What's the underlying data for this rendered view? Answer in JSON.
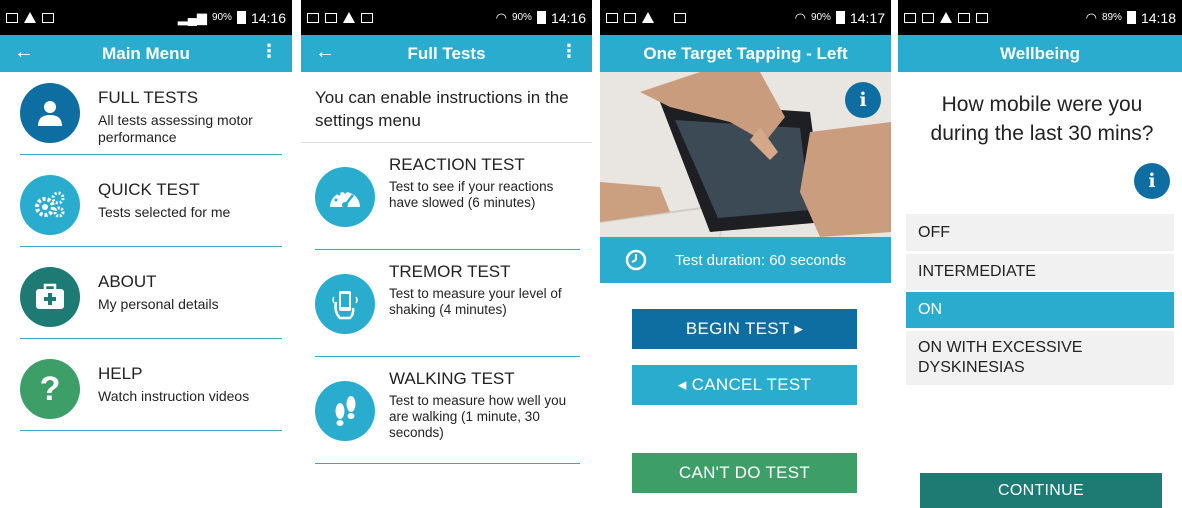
{
  "status_bars": [
    {
      "time": "14:16",
      "battery": "90%"
    },
    {
      "time": "14:16",
      "battery": "90%"
    },
    {
      "time": "14:17",
      "battery": "90%"
    },
    {
      "time": "14:18",
      "battery": "89%"
    }
  ],
  "colors": {
    "appbar": "#2aaccf",
    "dark_blue": "#0f6ea1",
    "teal": "#1d7b74",
    "green": "#3d9e67"
  },
  "main_menu": {
    "title": "Main Menu",
    "items": [
      {
        "title": "FULL TESTS",
        "subtitle": "All tests assessing motor performance",
        "icon": "person-icon"
      },
      {
        "title": "QUICK TEST",
        "subtitle": "Tests selected for me",
        "icon": "gears-icon"
      },
      {
        "title": "ABOUT",
        "subtitle": "My personal details",
        "icon": "medical-kit-icon"
      },
      {
        "title": "HELP",
        "subtitle": "Watch instruction videos",
        "icon": "question-icon"
      }
    ]
  },
  "full_tests": {
    "title": "Full Tests",
    "intro": "You can enable instructions in the settings menu",
    "items": [
      {
        "title": "REACTION TEST",
        "subtitle": "Test to see if your reactions have slowed (6 minutes)",
        "icon": "speedometer-icon"
      },
      {
        "title": "TREMOR TEST",
        "subtitle": "Test to measure your level of shaking (4 minutes)",
        "icon": "phone-hand-icon"
      },
      {
        "title": "WALKING TEST",
        "subtitle": "Test to measure how well you are walking (1 minute, 30 seconds)",
        "icon": "footprints-icon"
      }
    ]
  },
  "tapping": {
    "title": "One Target Tapping - Left",
    "duration": "Test duration: 60 seconds",
    "begin": "BEGIN TEST ▸",
    "cancel": "◂ CANCEL TEST",
    "cant": "CAN'T DO TEST"
  },
  "wellbeing": {
    "title": "Wellbeing",
    "question": "How mobile were you during the last 30 mins?",
    "options": [
      "OFF",
      "INTERMEDIATE",
      "ON",
      "ON WITH EXCESSIVE DYSKINESIAS"
    ],
    "selected": "ON",
    "continue": "CONTINUE"
  }
}
